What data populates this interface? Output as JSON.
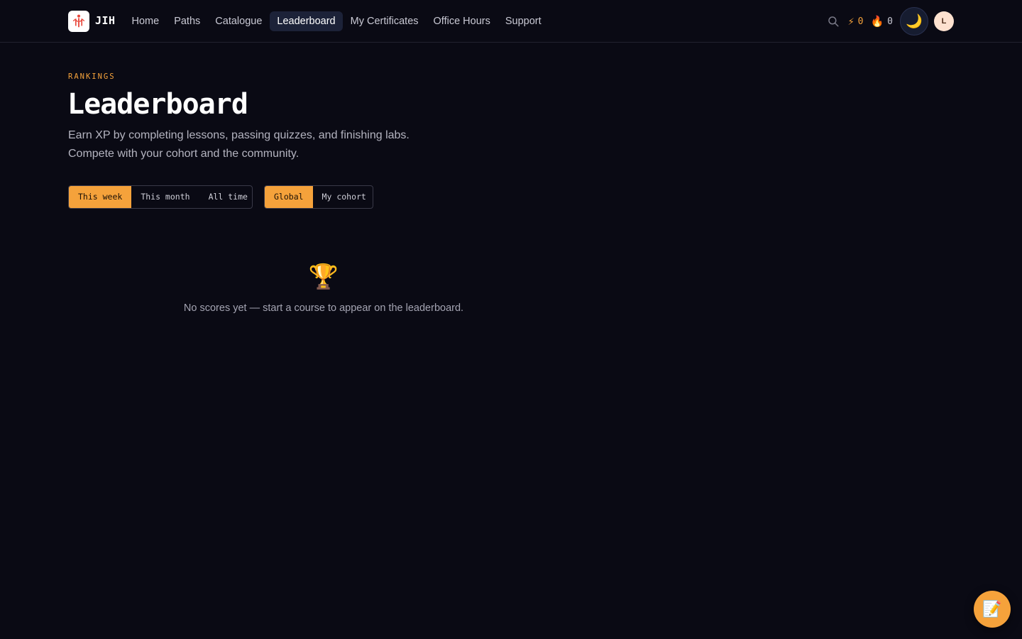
{
  "header": {
    "brand": "JIH",
    "nav": [
      {
        "label": "Home"
      },
      {
        "label": "Paths"
      },
      {
        "label": "Catalogue"
      },
      {
        "label": "Leaderboard",
        "active": true
      },
      {
        "label": "My Certificates"
      },
      {
        "label": "Office Hours"
      },
      {
        "label": "Support"
      }
    ],
    "xp_value": "0",
    "streak_value": "0",
    "avatar_initial": "L",
    "icons": {
      "search": "search-icon",
      "xp": "lightning-icon",
      "streak": "flame-icon",
      "theme": "moon-icon"
    }
  },
  "main": {
    "eyebrow": "RANKINGS",
    "title": "Leaderboard",
    "subtitle": "Earn XP by completing lessons, passing quizzes, and finishing labs. Compete with your cohort and the community.",
    "time_filters": [
      {
        "label": "This week",
        "active": true
      },
      {
        "label": "This month"
      },
      {
        "label": "All time"
      }
    ],
    "scope_filters": [
      {
        "label": "Global",
        "active": true
      },
      {
        "label": "My cohort"
      }
    ],
    "empty_state": {
      "icon": "trophy-icon",
      "text": "No scores yet — start a course to appear on the leaderboard."
    }
  },
  "fab": {
    "icon": "memo-icon"
  },
  "colors": {
    "background": "#0a0a14",
    "accent": "#f5a23b",
    "nav_active_bg": "#1c2238",
    "avatar_bg": "#fde1cf"
  }
}
